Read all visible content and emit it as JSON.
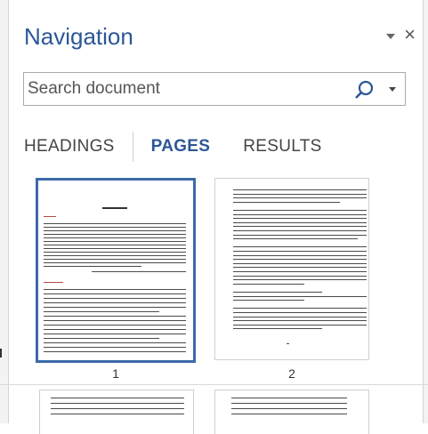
{
  "panel": {
    "title": "Navigation"
  },
  "search": {
    "placeholder": "Search document"
  },
  "tabs": [
    {
      "label": "HEADINGS",
      "active": false
    },
    {
      "label": "PAGES",
      "active": true
    },
    {
      "label": "RESULTS",
      "active": false
    }
  ],
  "pages": [
    {
      "number": "1",
      "selected": true
    },
    {
      "number": "2",
      "selected": false
    }
  ],
  "colors": {
    "accent": "#2b5797",
    "selection": "#3c6aa8"
  }
}
